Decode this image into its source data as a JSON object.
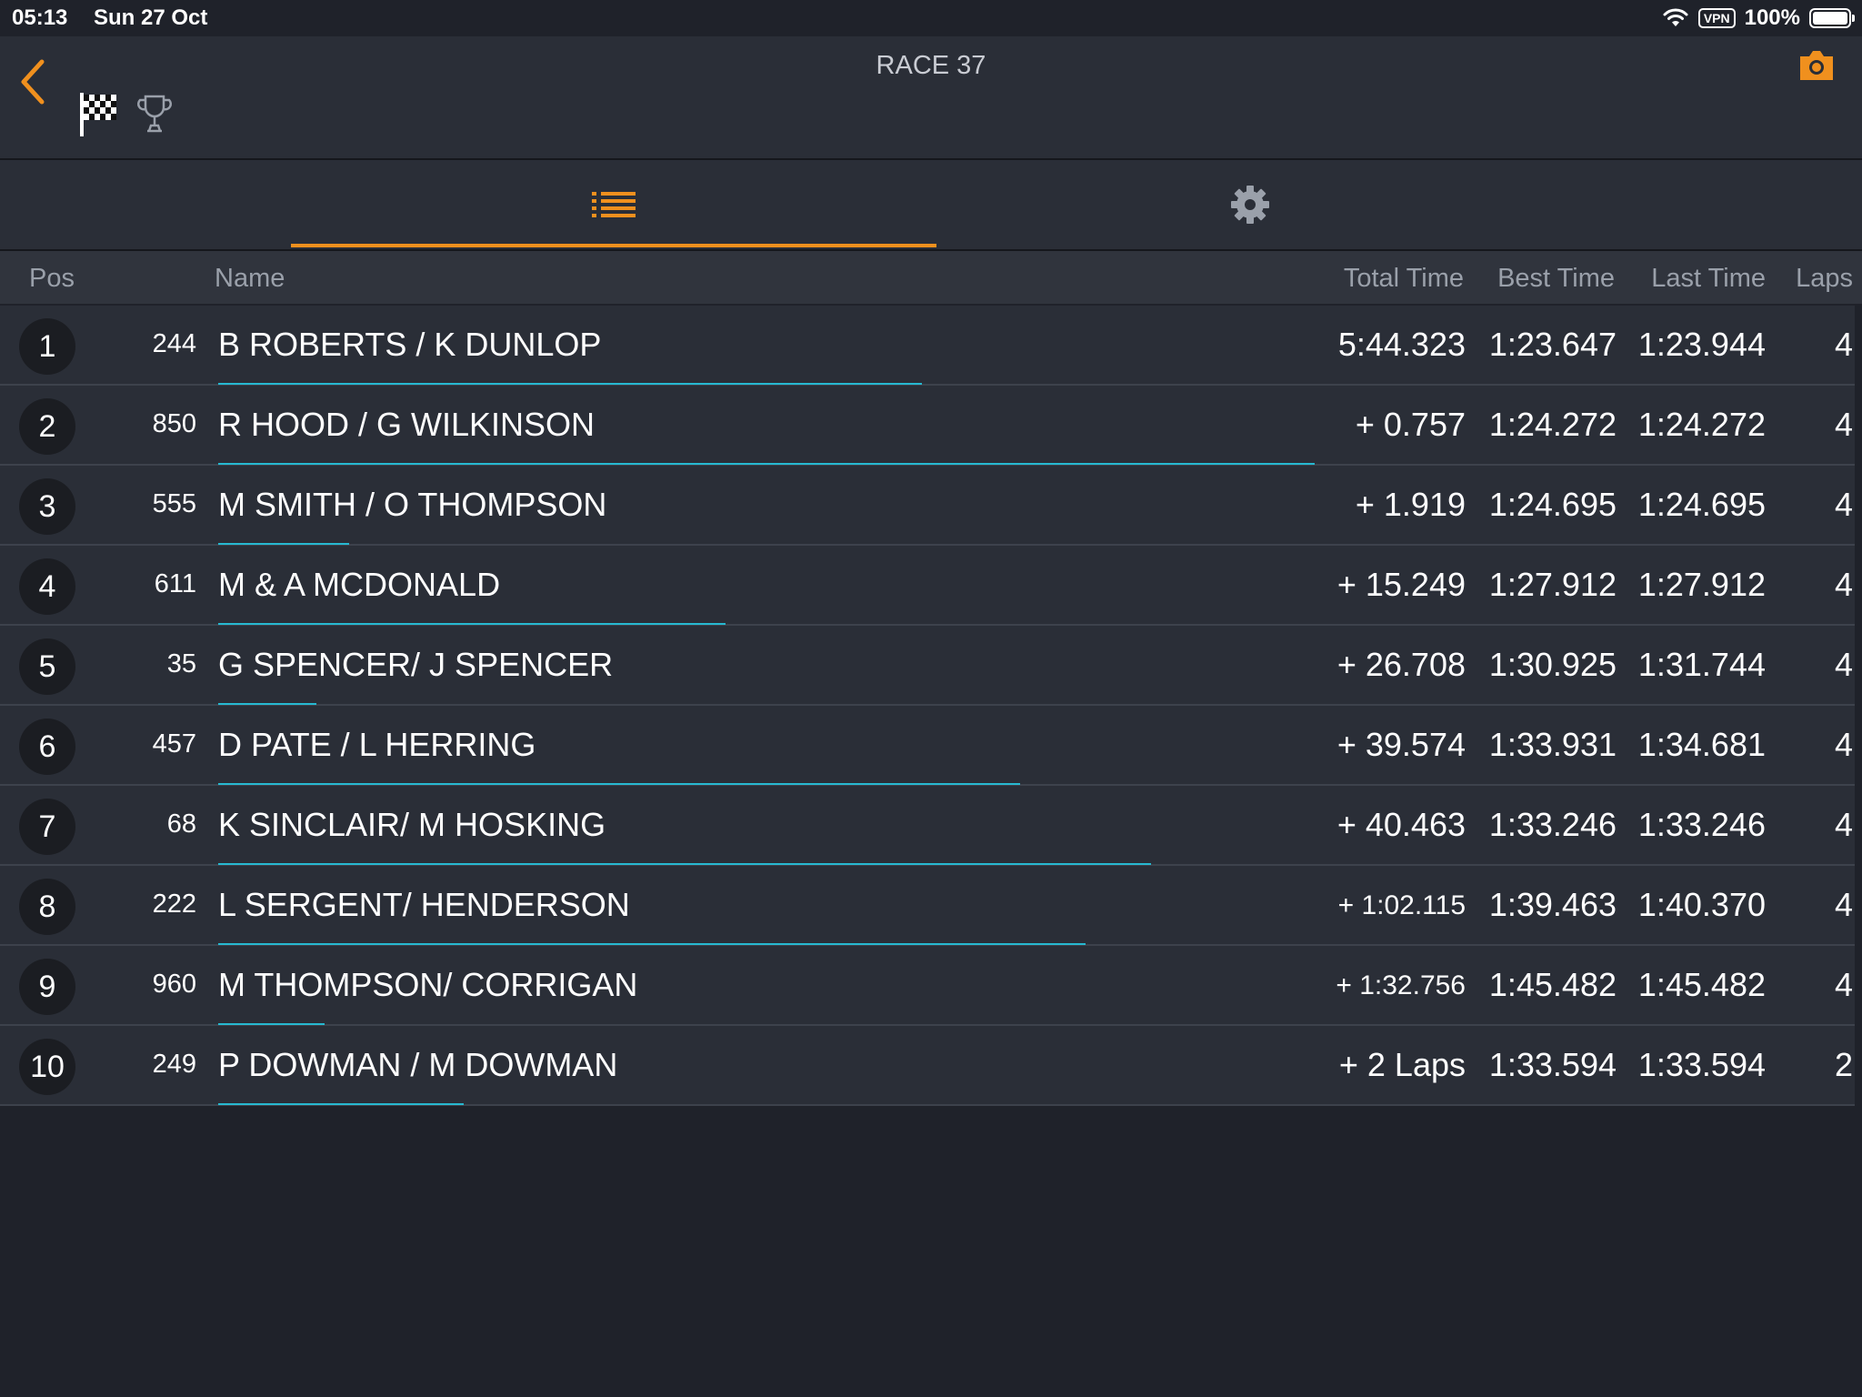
{
  "status": {
    "time": "05:13",
    "date": "Sun 27 Oct",
    "vpn": "VPN",
    "battery": "100%"
  },
  "header": {
    "title": "RACE 37"
  },
  "columns": {
    "pos": "Pos",
    "name": "Name",
    "total": "Total Time",
    "best": "Best Time",
    "last": "Last Time",
    "laps": "Laps"
  },
  "colors": {
    "accent": "#f0901e",
    "progress": "#27b9d1",
    "background": "#1f222a",
    "row": "#2a2e37"
  },
  "rows": [
    {
      "pos": "1",
      "num": "244",
      "name": "B ROBERTS / K DUNLOP",
      "total": "5:44.323",
      "best": "1:23.647",
      "last": "1:23.944",
      "laps": "4",
      "progress": 0.43
    },
    {
      "pos": "2",
      "num": "850",
      "name": "R HOOD / G WILKINSON",
      "total": "+ 0.757",
      "best": "1:24.272",
      "last": "1:24.272",
      "laps": "4",
      "progress": 0.67
    },
    {
      "pos": "3",
      "num": "555",
      "name": "M SMITH / O THOMPSON",
      "total": "+ 1.919",
      "best": "1:24.695",
      "last": "1:24.695",
      "laps": "4",
      "progress": 0.08
    },
    {
      "pos": "4",
      "num": "611",
      "name": "M & A MCDONALD",
      "total": "+ 15.249",
      "best": "1:27.912",
      "last": "1:27.912",
      "laps": "4",
      "progress": 0.31
    },
    {
      "pos": "5",
      "num": "35",
      "name": "G SPENCER/ J SPENCER",
      "total": "+ 26.708",
      "best": "1:30.925",
      "last": "1:31.744",
      "laps": "4",
      "progress": 0.06
    },
    {
      "pos": "6",
      "num": "457",
      "name": "D PATE / L HERRING",
      "total": "+ 39.574",
      "best": "1:33.931",
      "last": "1:34.681",
      "laps": "4",
      "progress": 0.49
    },
    {
      "pos": "7",
      "num": "68",
      "name": "K SINCLAIR/ M HOSKING",
      "total": "+ 40.463",
      "best": "1:33.246",
      "last": "1:33.246",
      "laps": "4",
      "progress": 0.57
    },
    {
      "pos": "8",
      "num": "222",
      "name": "L SERGENT/ HENDERSON",
      "total": "+ 1:02.115",
      "best": "1:39.463",
      "last": "1:40.370",
      "laps": "4",
      "progress": 0.53
    },
    {
      "pos": "9",
      "num": "960",
      "name": "M THOMPSON/ CORRIGAN",
      "total": "+ 1:32.756",
      "best": "1:45.482",
      "last": "1:45.482",
      "laps": "4",
      "progress": 0.065
    },
    {
      "pos": "10",
      "num": "249",
      "name": "P DOWMAN / M DOWMAN",
      "total": "+ 2 Laps",
      "best": "1:33.594",
      "last": "1:33.594",
      "laps": "2",
      "progress": 0.15
    }
  ]
}
